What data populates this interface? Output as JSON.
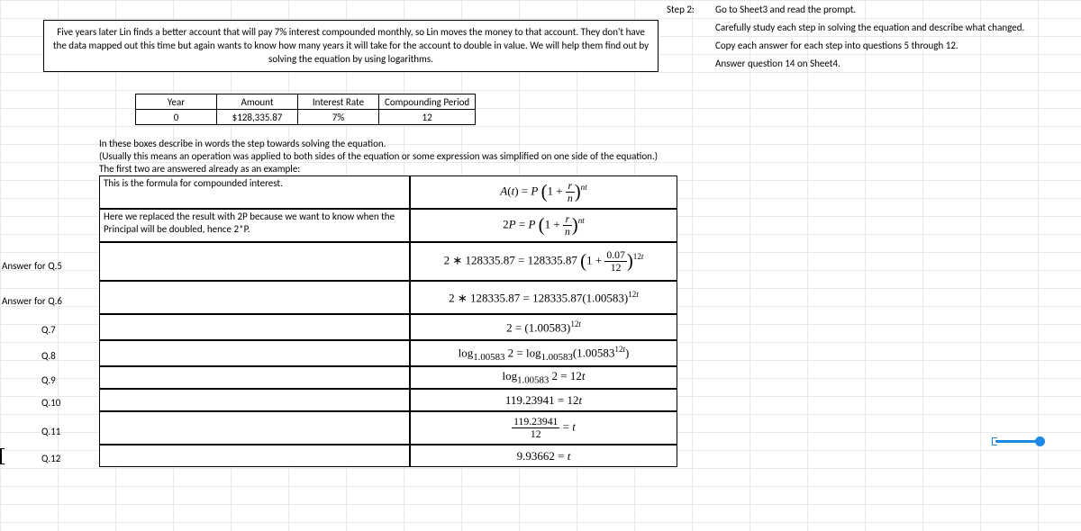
{
  "prompt": "Five years later Lin finds a better account that will pay 7% interest compounded monthly, so Lin moves the money to that account.  They don't have the data mapped out this time but again wants to know how many years it will take for the account to double in value.  We will help them find out by solving the equation by using logarithms.",
  "step2": {
    "label": "Step 2:",
    "lines": [
      "Go to Sheet3 and read the prompt.",
      "Carefully study each step in solving the equation and describe what changed.",
      "Copy each answer for each step into questions 5 through 12.",
      "Answer question 14 on Sheet4."
    ]
  },
  "params": {
    "headers": [
      "Year",
      "Amount",
      "Interest Rate",
      "Compounding Period"
    ],
    "values": [
      "0",
      "$128,335.87",
      "7%",
      "12"
    ]
  },
  "instructions": [
    "In these boxes describe in words the step towards solving the equation.",
    "(Usually this means an operation was applied to both sides of the equation or some expression was simplified on one side of the equation.)",
    "The first two are answered already as an example:"
  ],
  "rows": [
    {
      "desc": "This is the formula for compounded interest.",
      "eq": "A(t) = P\\left(1+\\frac{r}{n}\\right)^{nt}"
    },
    {
      "desc": "Here we replaced the result with 2P because we want to know when the Principal will be doubled, hence 2*P.",
      "eq": "2P = P\\left(1+\\frac{r}{n}\\right)^{nt}"
    },
    {
      "desc": "",
      "eq": "2 * 128335.87 = 128335.87\\left(1+\\frac{0.07}{12}\\right)^{12t}"
    },
    {
      "desc": "",
      "eq": "2 * 128335.87 = 128335.87(1.00583)^{12t}"
    },
    {
      "desc": "",
      "eq": "2 = (1.00583)^{12t}"
    },
    {
      "desc": "",
      "eq": "\\log_{1.00583} 2 = \\log_{1.00583}(1.00583^{12t})"
    },
    {
      "desc": "",
      "eq": "\\log_{1.00583} 2 = 12t"
    },
    {
      "desc": "",
      "eq": "119.23941 = 12t"
    },
    {
      "desc": "",
      "eq": "\\frac{119.23941}{12} = t"
    },
    {
      "desc": "",
      "eq": "9.93662 = t"
    }
  ],
  "qlabels": {
    "q5": "Answer for Q.5",
    "q6": "Answer for Q.6",
    "q7": "Q.7",
    "q8": "Q.8",
    "q9": "Q.9",
    "q10": "Q.10",
    "q11": "Q.11",
    "q12": "Q.12"
  }
}
